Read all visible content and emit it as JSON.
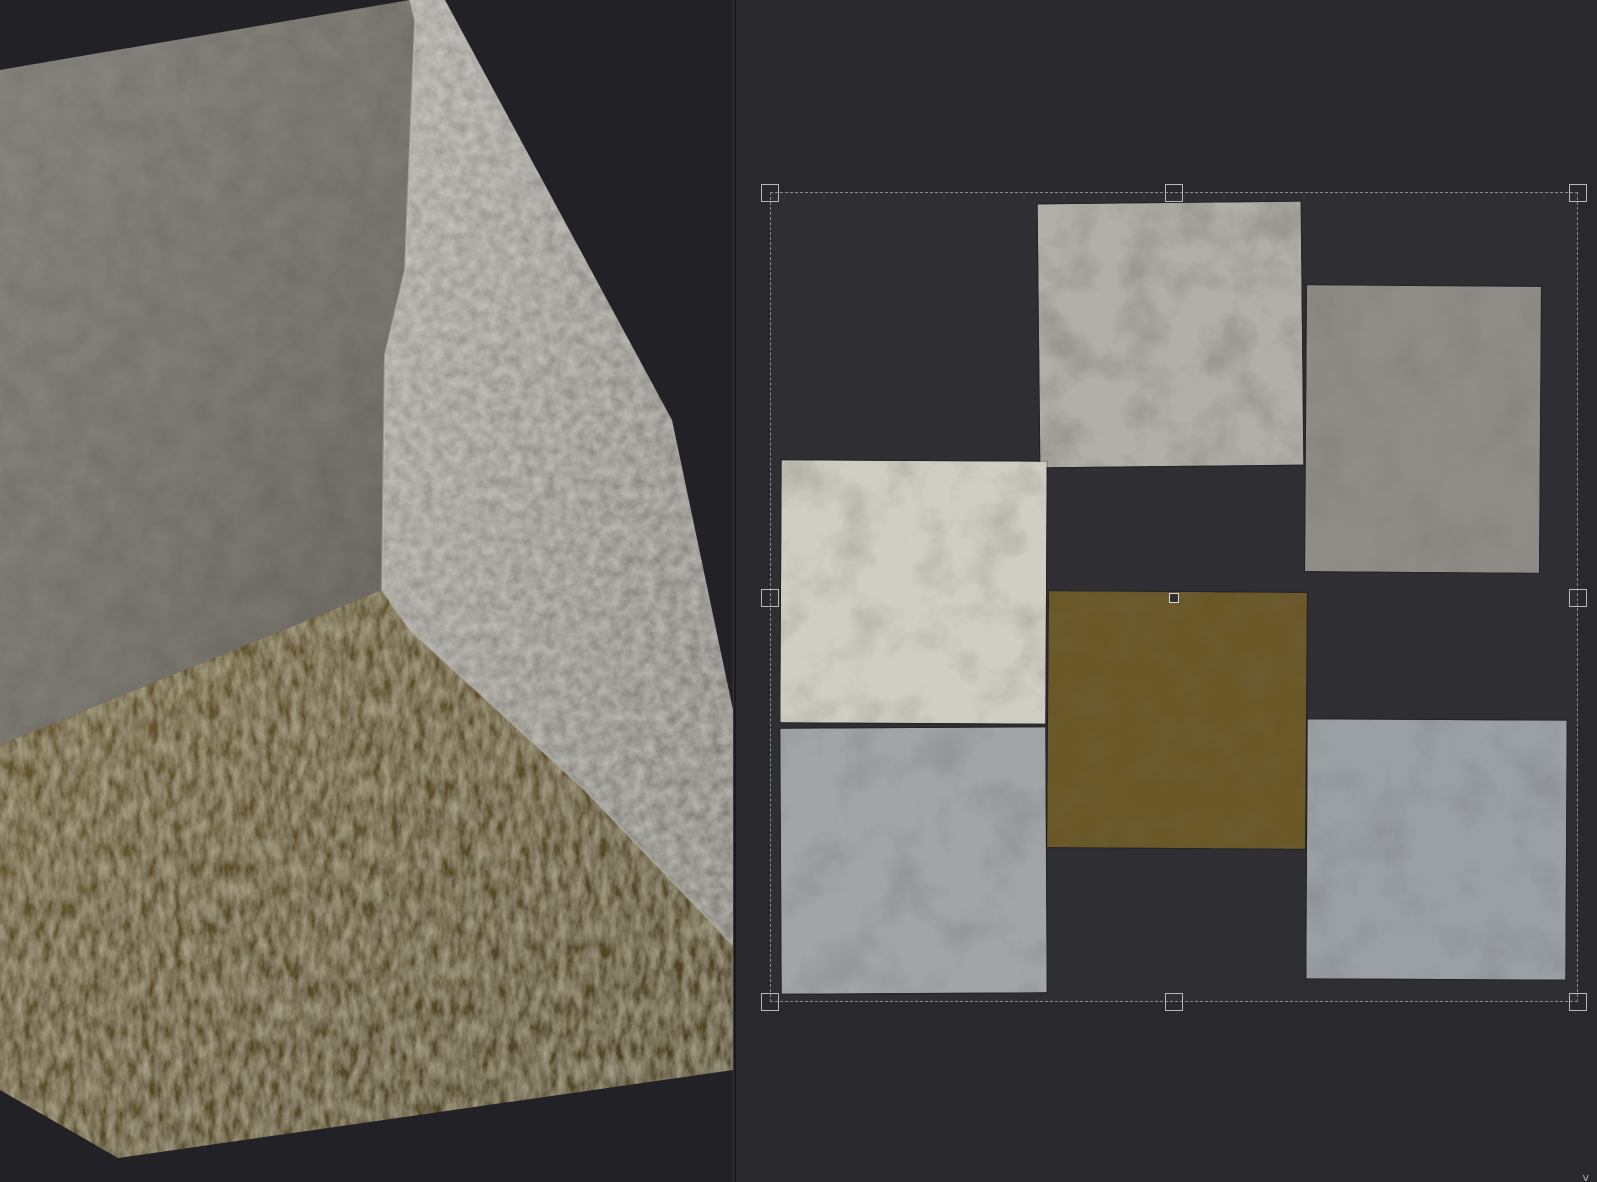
{
  "app": {
    "panels": [
      "3d-viewport",
      "uv-editor"
    ]
  },
  "colors": {
    "background": "#242428",
    "uv_bounds": "#2f2f33",
    "selection_frame": "#8a8a8e",
    "stone_light": "#c9c6bd",
    "stone_mid": "#8f8e88",
    "stone_dark": "#5e5d55",
    "dirt": "#5e4d1f",
    "stone_blue": "#9ea3a8"
  },
  "viewport_3d": {
    "object": "cube",
    "faces": [
      "top-stone",
      "side-stone",
      "bottom-dirt"
    ]
  },
  "uv_editor": {
    "islands": [
      {
        "name": "top-center",
        "tone": "light-gray-stone"
      },
      {
        "name": "top-right",
        "tone": "gray-stone"
      },
      {
        "name": "middle-left",
        "tone": "pale-stone"
      },
      {
        "name": "center",
        "tone": "dirt"
      },
      {
        "name": "bottom-left",
        "tone": "blue-gray-stone"
      },
      {
        "name": "bottom-right",
        "tone": "blue-gray-stone"
      }
    ],
    "axis_label": "v"
  }
}
